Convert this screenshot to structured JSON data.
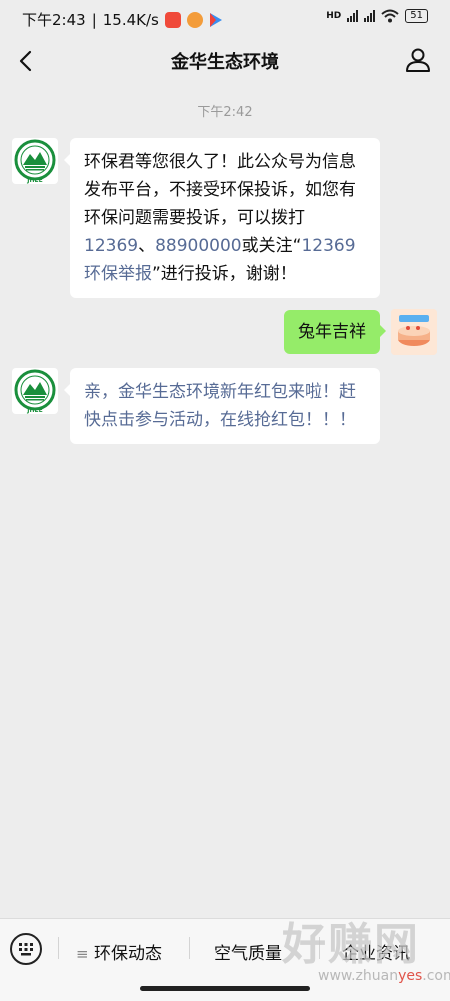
{
  "status_bar": {
    "time": "下午2:43",
    "speed": "15.4K/s",
    "network": "HD",
    "battery": "51"
  },
  "header": {
    "title": "金华生态环境"
  },
  "chat": {
    "timestamp": "下午2:42",
    "messages": [
      {
        "side": "left",
        "segments": [
          {
            "text": "环保君等您很久了！此公众号为信息发布平台，不接受环保投诉，如您有环保问题需要投诉，可以拨打"
          },
          {
            "text": "12369",
            "link": true
          },
          {
            "text": "、"
          },
          {
            "text": "88900000",
            "link": true
          },
          {
            "text": "或关注“"
          },
          {
            "text": "12369环保举报",
            "link": true
          },
          {
            "text": "”进行投诉，谢谢！"
          }
        ]
      },
      {
        "side": "right",
        "text": "兔年吉祥"
      },
      {
        "side": "left",
        "text": "亲，金华生态环境新年红包来啦！赶快点击参与活动，在线抢红包！！！"
      }
    ]
  },
  "bottom_menu": {
    "items": [
      "环保动态",
      "空气质量",
      "企业资讯"
    ]
  },
  "watermark": {
    "big": "好赚网",
    "small_prefix": "www.zhuan",
    "small_red": "yes",
    "small_suffix": ".com"
  },
  "colors": {
    "background": "#ededed",
    "bubble_green": "#95ec69",
    "link": "#576b95",
    "logo_green": "#1a8f3c"
  }
}
